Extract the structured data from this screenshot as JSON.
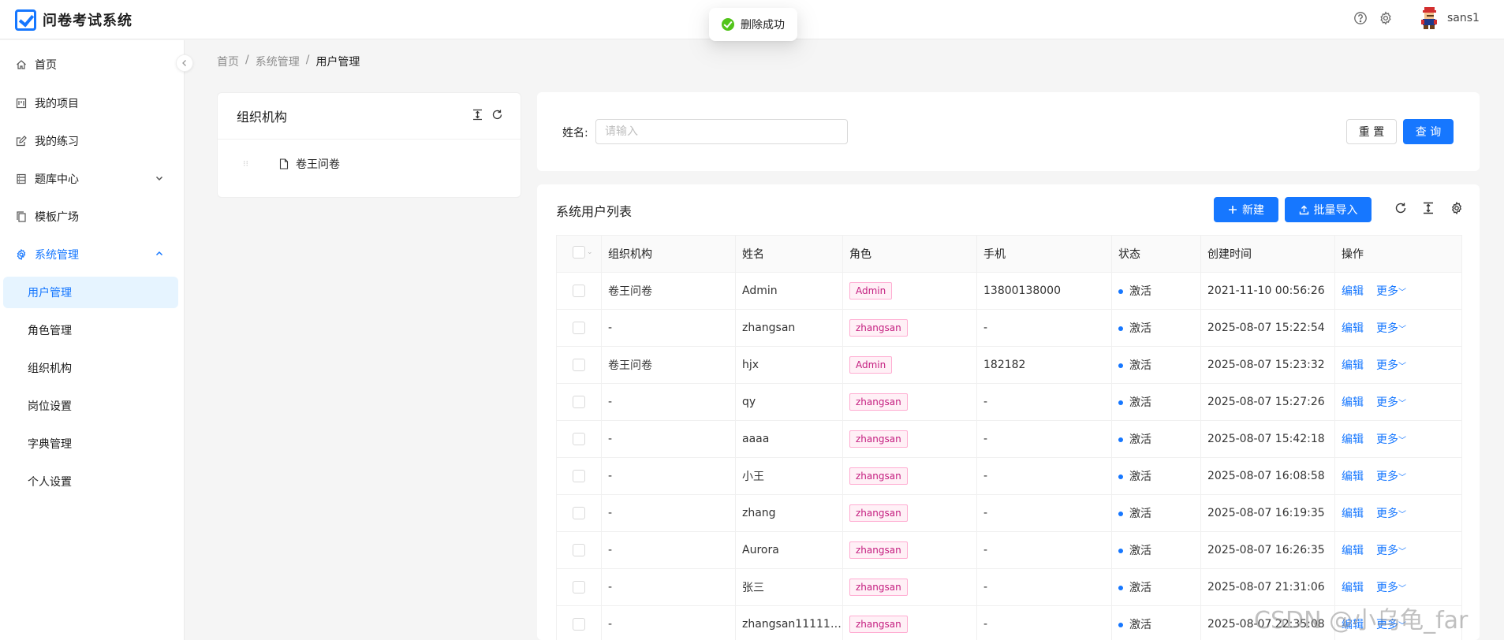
{
  "app": {
    "title": "问卷考试系统"
  },
  "toast": {
    "message": "删除成功"
  },
  "user": {
    "name": "sans1"
  },
  "sidebar": {
    "items": [
      {
        "label": "首页",
        "icon": "home-icon"
      },
      {
        "label": "我的项目",
        "icon": "project-icon"
      },
      {
        "label": "我的练习",
        "icon": "edit-icon"
      },
      {
        "label": "题库中心",
        "icon": "database-icon"
      },
      {
        "label": "模板广场",
        "icon": "copy-icon"
      },
      {
        "label": "系统管理",
        "icon": "setting-icon"
      }
    ],
    "sub_items": [
      "用户管理",
      "角色管理",
      "组织机构",
      "岗位设置",
      "字典管理",
      "个人设置"
    ]
  },
  "breadcrumb": {
    "home": "首页",
    "section": "系统管理",
    "current": "用户管理"
  },
  "org": {
    "title": "组织机构",
    "node": "卷王问卷"
  },
  "search": {
    "label": "姓名:",
    "placeholder": "请输入",
    "value": "",
    "reset": "重 置",
    "query": "查 询"
  },
  "table": {
    "title": "系统用户列表",
    "new_button": "新建",
    "import_button": "批量导入",
    "columns": [
      "组织机构",
      "姓名",
      "角色",
      "手机",
      "状态",
      "创建时间",
      "操作"
    ],
    "edit_label": "编辑",
    "more_label": "更多",
    "rows": [
      {
        "org": "卷王问卷",
        "name": "Admin",
        "role": "Admin",
        "phone": "13800138000",
        "status": "激活",
        "created": "2021-11-10 00:56:26"
      },
      {
        "org": "-",
        "name": "zhangsan",
        "role": "zhangsan",
        "phone": "-",
        "status": "激活",
        "created": "2025-08-07 15:22:54"
      },
      {
        "org": "卷王问卷",
        "name": "hjx",
        "role": "Admin",
        "phone": "182182",
        "status": "激活",
        "created": "2025-08-07 15:23:32"
      },
      {
        "org": "-",
        "name": "qy",
        "role": "zhangsan",
        "phone": "-",
        "status": "激活",
        "created": "2025-08-07 15:27:26"
      },
      {
        "org": "-",
        "name": "aaaa",
        "role": "zhangsan",
        "phone": "-",
        "status": "激活",
        "created": "2025-08-07 15:42:18"
      },
      {
        "org": "-",
        "name": "小王",
        "role": "zhangsan",
        "phone": "-",
        "status": "激活",
        "created": "2025-08-07 16:08:58"
      },
      {
        "org": "-",
        "name": "zhang",
        "role": "zhangsan",
        "phone": "-",
        "status": "激活",
        "created": "2025-08-07 16:19:35"
      },
      {
        "org": "-",
        "name": "Aurora",
        "role": "zhangsan",
        "phone": "-",
        "status": "激活",
        "created": "2025-08-07 16:26:35"
      },
      {
        "org": "-",
        "name": "张三",
        "role": "zhangsan",
        "phone": "-",
        "status": "激活",
        "created": "2025-08-07 21:31:06"
      },
      {
        "org": "-",
        "name": "zhangsan111111...",
        "role": "zhangsan",
        "phone": "-",
        "status": "激活",
        "created": "2025-08-07 22:35:08"
      }
    ]
  },
  "watermark": "CSDN @小乌龟_far",
  "colors": {
    "primary": "#1677ff",
    "success": "#52c41a",
    "tag_text": "#c41d7f",
    "tag_border": "#ffadd2",
    "tag_bg": "#fff0f6"
  }
}
